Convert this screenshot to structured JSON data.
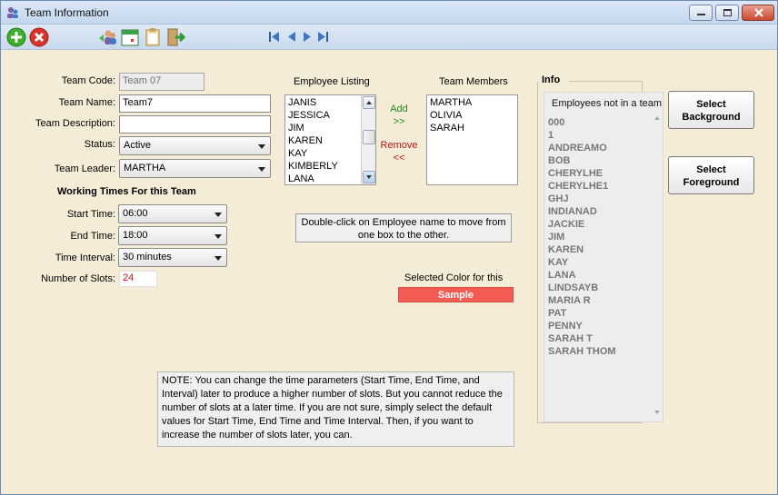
{
  "window": {
    "title": "Team Information"
  },
  "colors": {
    "accent": "#2d6aa6",
    "sample": "#f25c55",
    "add": "#1e8a1e",
    "remove": "#b01818",
    "slots": "#c81414"
  },
  "toolbar": {
    "icons": [
      "add-icon",
      "delete-icon",
      "users-icon",
      "calendar-icon",
      "clipboard-icon",
      "exit-icon"
    ],
    "nav": [
      "first-record-icon",
      "prev-record-icon",
      "next-record-icon",
      "last-record-icon"
    ]
  },
  "form": {
    "team_code_label": "Team Code:",
    "team_code_value": "Team 07",
    "team_name_label": "Team Name:",
    "team_name_value": "Team7",
    "team_description_label": "Team Description:",
    "team_description_value": "",
    "status_label": "Status:",
    "status_value": "Active",
    "team_leader_label": "Team Leader:",
    "team_leader_value": "MARTHA"
  },
  "working_times": {
    "title": "Working Times For this Team",
    "start_label": "Start Time:",
    "start_value": "06:00",
    "end_label": "End Time:",
    "end_value": "18:00",
    "interval_label": "Time Interval:",
    "interval_value": "30 minutes",
    "slots_label": "Number of Slots:",
    "slots_value": "24"
  },
  "employee_listing": {
    "title": "Employee Listing",
    "items": [
      "JANIS",
      "JESSICA",
      "JIM",
      "KAREN",
      "KAY",
      "KIMBERLY",
      "LANA"
    ]
  },
  "team_members": {
    "title": "Team Members",
    "items": [
      "MARTHA",
      "OLIVIA",
      "SARAH"
    ]
  },
  "actions": {
    "add_label": "Add",
    "add_arrows": ">>",
    "remove_label": "Remove",
    "remove_arrows": "<<"
  },
  "hint": "Double-click on Employee name to move from one box to the other.",
  "color_section": {
    "label": "Selected Color for this",
    "sample": "Sample"
  },
  "info": {
    "legend": "Info",
    "header": "Employees not in a team",
    "items": [
      "000",
      "1",
      "ANDREAMO",
      "BOB",
      "CHERYLHE",
      "CHERYLHE1",
      "GHJ",
      "INDIANAD",
      "JACKIE",
      "JIM",
      "KAREN",
      "KAY",
      "LANA",
      "LINDSAYB",
      "MARIA R",
      "PAT",
      "PENNY",
      "SARAH T",
      "SARAH THOM"
    ]
  },
  "buttons": {
    "select_background": "Select Background",
    "select_foreground": "Select Foreground"
  },
  "note": "NOTE: You can change the time parameters (Start Time, End Time, and Interval) later to produce a higher number of slots. But you cannot reduce the number of slots at a later time. If you are not sure, simply select the default values for Start Time, End Time and Time Interval. Then, if you want to increase the number of slots later, you can."
}
